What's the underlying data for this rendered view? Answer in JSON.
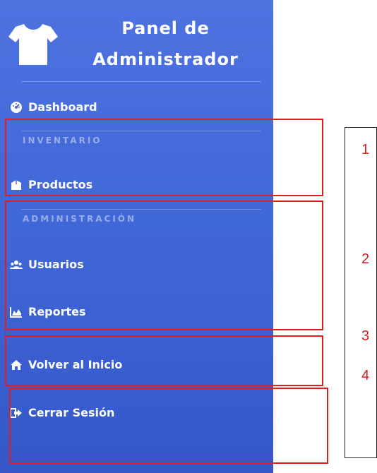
{
  "brand": {
    "line1": "Panel de",
    "line2": "Administrador",
    "icon": "tshirt-icon"
  },
  "nav": {
    "dashboard": {
      "label": "Dashboard",
      "icon": "dashboard-gauge-icon"
    },
    "inventory_section": "INVENTARIO",
    "productos": {
      "label": "Productos",
      "icon": "box-icon"
    },
    "admin_section": "ADMINISTRACIÓN",
    "usuarios": {
      "label": "Usuarios",
      "icon": "users-icon"
    },
    "reportes": {
      "label": "Reportes",
      "icon": "area-chart-icon"
    },
    "volver": {
      "label": "Volver al Inicio",
      "icon": "home-icon"
    },
    "cerrar": {
      "label": "Cerrar Sesión",
      "icon": "sign-out-icon"
    }
  },
  "annotations": {
    "n1": "1",
    "n2": "2",
    "n3": "3",
    "n4": "4"
  },
  "colors": {
    "sidebar_top": "#4e72e0",
    "sidebar_bottom": "#3557c9",
    "highlight": "#e01e1e",
    "annotation_text": "#d42020"
  }
}
